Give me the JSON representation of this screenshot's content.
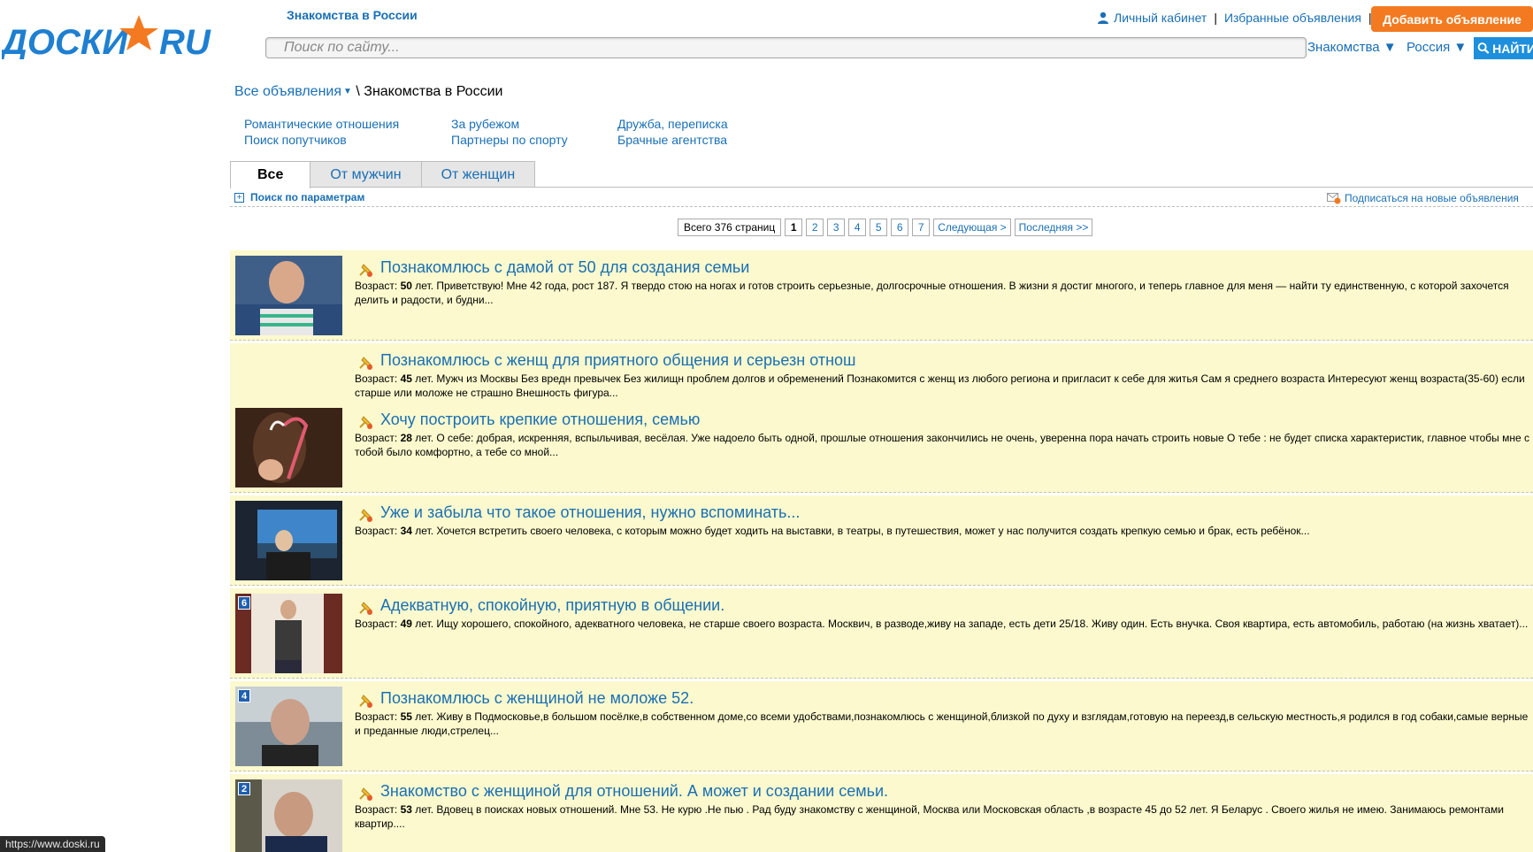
{
  "logo": {
    "text_left": "ДОСКИ",
    "text_right": "RU"
  },
  "header": {
    "region_title": "Знакомства в России",
    "cabinet": "Личный кабинет",
    "separator": "|",
    "favorites": "Избранные объявления",
    "add_button": "Добавить объявление"
  },
  "search": {
    "placeholder": "Поиск по сайту...",
    "category_select": "Знакомства ▼",
    "region_select": "Россия ▼",
    "find_button": "НАЙТИ"
  },
  "breadcrumb": {
    "root": "Все объявления",
    "sep": "\\",
    "current": "Знакомства в России"
  },
  "categories": [
    [
      "Романтические отношения",
      "Поиск попутчиков"
    ],
    [
      "За рубежом",
      "Партнеры по спорту"
    ],
    [
      "Дружба, переписка",
      "Брачные агентства"
    ]
  ],
  "tabs": [
    "Все",
    "От мужчин",
    "От женщин"
  ],
  "filters": {
    "param_search": "Поиск по параметрам",
    "subscribe": "Подписаться на новые объявления"
  },
  "pagination": {
    "total": "Всего 376 страниц",
    "pages": [
      "1",
      "2",
      "3",
      "4",
      "5",
      "6",
      "7"
    ],
    "current": "1",
    "next": "Следующая >",
    "last": "Последняя >>"
  },
  "age_label": "Возраст:",
  "listings": [
    {
      "title": "Познакомлюсь с дамой от 50 для создания семьи",
      "age": "50",
      "text": " лет. Приветствую! Мне 42 года, рост 187. Я твердо стою на ногах и готов строить серьезные, долгосрочные отношения. В жизни я достиг многого, и теперь главное для меня — найти ту единственную, с которой захочется делить и радости, и будни...",
      "photo_count": ""
    },
    {
      "title": "Познакомлюсь с женщ для приятного общения и серьезн отнош",
      "age": "45",
      "text": " лет. Мужч из Москвы Без вредн превычек Без жилищн проблем долгов и обременений Познакомится с женщ из любого региона и пригласит к себе для житья Сам я среднего возраста Интересуют женщ возраста(35-60) если старше или моложе не страшно Внешность фигура...",
      "photo_count": ""
    },
    {
      "title": "Хочу построить крепкие отношения, семью",
      "age": "28",
      "text": " лет. О себе: добрая, искренняя, вспыльчивая, весёлая. Уже надоело быть одной, прошлые отношения закончились не очень, уверенна пора начать строить новые О тебе : не будет списка характеристик, главное чтобы мне с тобой было комфортно, а тебе со мной...",
      "photo_count": ""
    },
    {
      "title": "Уже и забыла что такое отношения, нужно вспоминать...",
      "age": "34",
      "text": " лет. Хочется встретить своего человека, с которым можно будет ходить на выставки, в театры, в путешествия, может у нас получится создать крепкую семью и брак, есть ребёнок...",
      "photo_count": ""
    },
    {
      "title": "Адекватную, спокойную, приятную в общении.",
      "age": "49",
      "text": " лет. Ищу хорошего, спокойного, адекватного человека, не старше своего возраста. Москвич, в разводе,живу на западе, есть дети 25/18. Живу один. Есть внучка. Своя квартира, есть автомобиль, работаю (на жизнь хватает)...",
      "photo_count": "6"
    },
    {
      "title": "Познакомлюсь с женщиной не моложе 52.",
      "age": "55",
      "text": " лет. Живу в Подмосковье,в большом посёлке,в собственном доме,со всеми удобствами,познакомлюсь с женщиной,близкой по духу и взглядам,готовую на переезд,в сельскую местность,я родился в год собаки,самые верные и преданные люди,стрелец...",
      "photo_count": "4"
    },
    {
      "title": "Знакомство с женщиной для отношений. А может и создании семьи.",
      "age": "53",
      "text": " лет. Вдовец в поисках новых отношений. Мне 53. Не курю .Не пью . Рад буду знакомству с женщиной, Москва или Московская область ,в возрасте 45 до 52 лет. Я Беларус . Своего жилья не имею. Занимаюсь ремонтами квартир....",
      "photo_count": "2"
    }
  ],
  "status_url": "https://www.doski.ru",
  "colors": {
    "link": "#1a6fb5",
    "accent": "#f37a21",
    "listing_bg": "#fbf9cd"
  }
}
